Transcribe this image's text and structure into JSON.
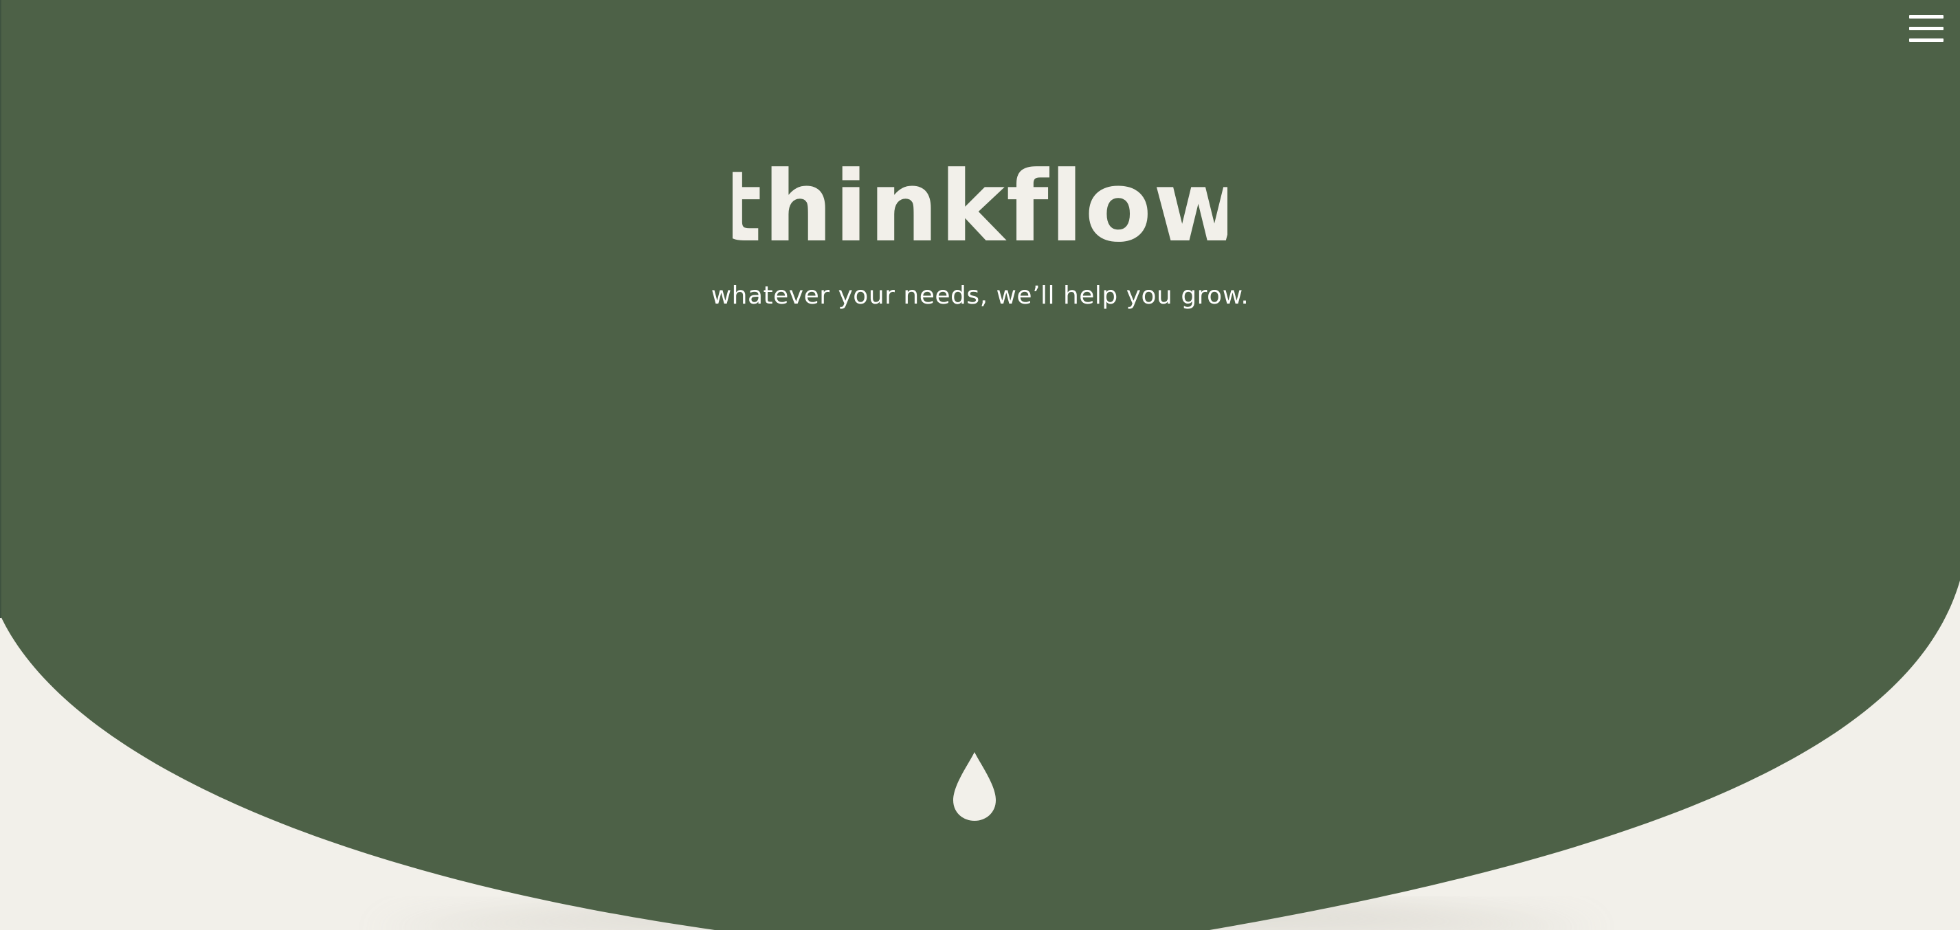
{
  "brand": {
    "name": "thinkflow",
    "tagline": "whatever your needs, we’ll help you grow."
  },
  "header": {
    "menu_icon": "hamburger-menu-icon"
  },
  "hero": {
    "scroll_icon": "water-drop-icon"
  },
  "colors": {
    "hero_green": "#4d6147",
    "cream": "#f2f0ea",
    "logo_text": "#f2f0ea",
    "tagline_text": "#ffffff"
  }
}
